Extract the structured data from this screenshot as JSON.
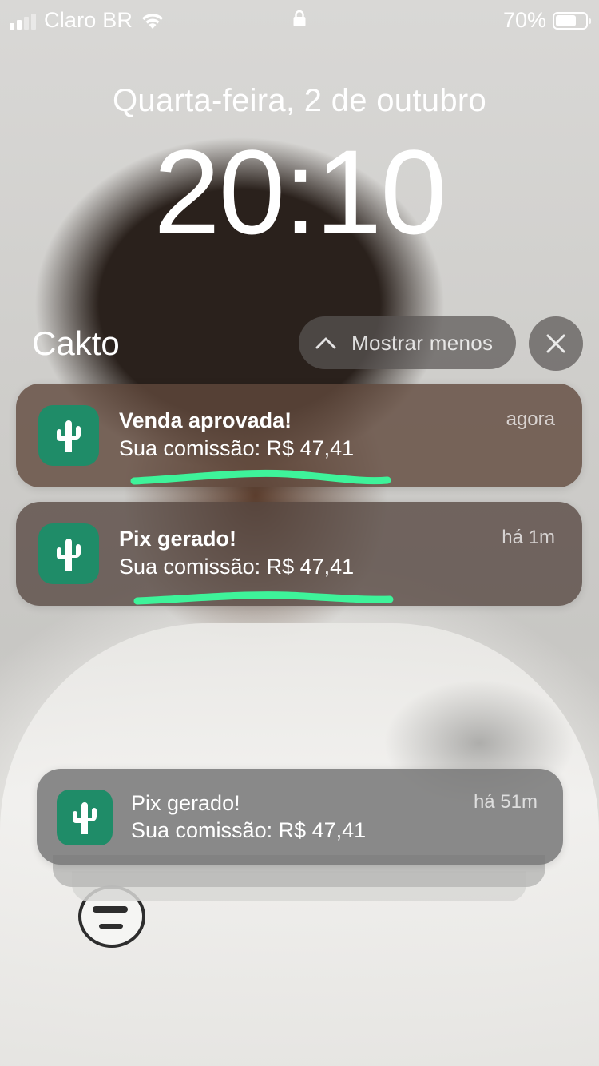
{
  "status_bar": {
    "carrier": "Claro BR",
    "battery_percent": "70%",
    "battery_level": 0.7,
    "icons": [
      "signal-icon",
      "wifi-icon",
      "lock-icon",
      "battery-icon"
    ]
  },
  "lock_screen": {
    "date": "Quarta-feira, 2 de outubro",
    "time": "20:10"
  },
  "group": {
    "app_name": "Cakto",
    "show_less_label": "Mostrar menos"
  },
  "notifications": [
    {
      "title": "Venda aprovada!",
      "body": "Sua comissão: R$ 47,41",
      "time": "agora",
      "icon": "cactus-icon"
    },
    {
      "title": "Pix gerado!",
      "body": "Sua comissão: R$ 47,41",
      "time": "há 1m",
      "icon": "cactus-icon"
    },
    {
      "title": "Pix gerado!",
      "body": "Sua comissão: R$ 47,41",
      "time": "há 51m",
      "icon": "cactus-icon"
    }
  ],
  "colors": {
    "app_icon": "#1f8c68",
    "highlight": "#3ef39a"
  }
}
